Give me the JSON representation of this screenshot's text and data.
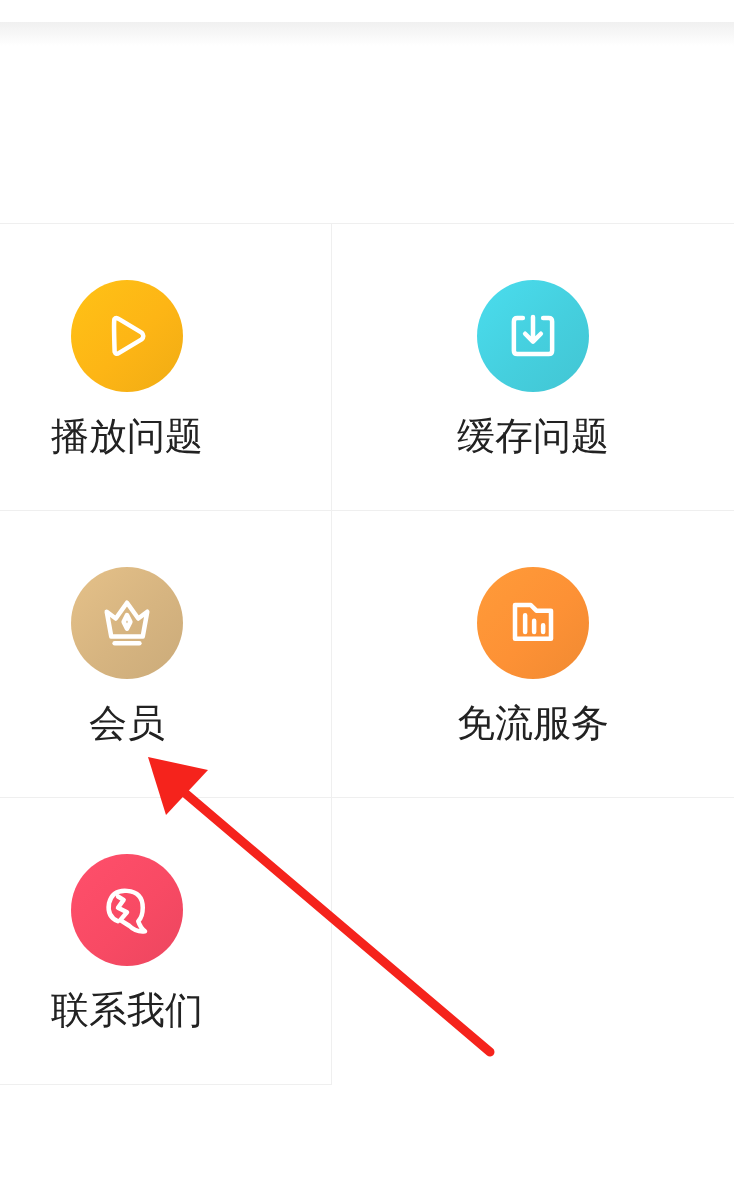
{
  "services": [
    {
      "label": "播放问题",
      "kind": "play",
      "color": "#fdb515"
    },
    {
      "label": "缓存问题",
      "kind": "download",
      "color": "#45cfde"
    },
    {
      "label": "会员",
      "kind": "crown",
      "color": "#d6b480"
    },
    {
      "label": "免流服务",
      "kind": "folder",
      "color": "#fd9135"
    },
    {
      "label": "联系我们",
      "kind": "chat",
      "color": "#f84a64"
    }
  ],
  "annotation": {
    "kind": "arrow"
  }
}
